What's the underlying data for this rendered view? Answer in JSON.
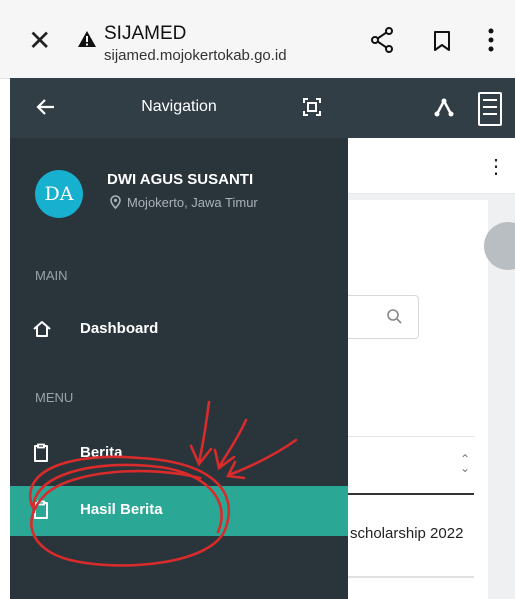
{
  "browser": {
    "title": "SIJAMED",
    "url": "sijamed.mojokertokab.go.id",
    "close_icon": "close-icon",
    "warning_icon": "warning-icon",
    "share_icon": "share-icon",
    "bookmark_icon": "bookmark-icon",
    "more_icon": "more-vert-icon"
  },
  "drawer": {
    "header_title": "Navigation",
    "user": {
      "initials": "DA",
      "name": "DWI AGUS SUSANTI",
      "location": "Mojokerto, Jawa Timur"
    },
    "sections": [
      {
        "label": "MAIN",
        "items": [
          {
            "label": "Dashboard",
            "icon": "home-icon"
          }
        ]
      },
      {
        "label": "MENU",
        "items": [
          {
            "label": "Berita",
            "icon": "clipboard-icon"
          },
          {
            "label": "Hasil Berita",
            "icon": "clipboard-icon",
            "active": true
          }
        ]
      }
    ]
  },
  "page": {
    "row_text": "scholarship 2022"
  },
  "colors": {
    "drawer_bg": "#29343b",
    "header_bg": "#323e46",
    "active_item": "#2aa895",
    "avatar": "#17b0cf",
    "annotation": "#d92b2b"
  }
}
